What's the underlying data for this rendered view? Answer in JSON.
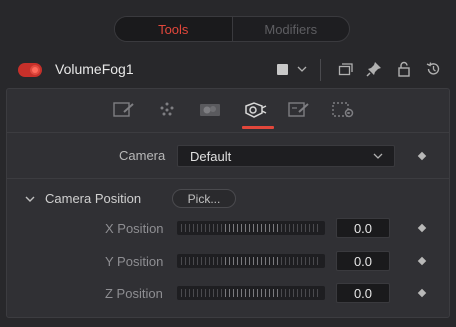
{
  "tabs": [
    {
      "label": "Tools",
      "active": true
    },
    {
      "label": "Modifiers",
      "active": false
    }
  ],
  "header": {
    "tool_name": "VolumeFog1",
    "enabled": true,
    "color_swatch": "#c9c9c9",
    "icons": [
      "chevron-down-icon",
      "window-icon",
      "pin-icon",
      "lock-icon",
      "reset-icon"
    ]
  },
  "control_tabs": [
    {
      "icon": "shape-icon",
      "active": false
    },
    {
      "icon": "color-dots-icon",
      "active": false
    },
    {
      "icon": "fog-image-icon",
      "active": false
    },
    {
      "icon": "camera-icon",
      "active": true
    },
    {
      "icon": "edit-icon",
      "active": false
    },
    {
      "icon": "settings-icon",
      "active": false
    }
  ],
  "camera": {
    "label": "Camera",
    "value": "Default"
  },
  "camera_position": {
    "label": "Camera Position",
    "pick_label": "Pick...",
    "fields": [
      {
        "label": "X Position",
        "value": "0.0"
      },
      {
        "label": "Y Position",
        "value": "0.0"
      },
      {
        "label": "Z Position",
        "value": "0.0"
      }
    ]
  },
  "colors": {
    "accent": "#e2473b",
    "background": "#28282b",
    "panel": "#303034"
  }
}
